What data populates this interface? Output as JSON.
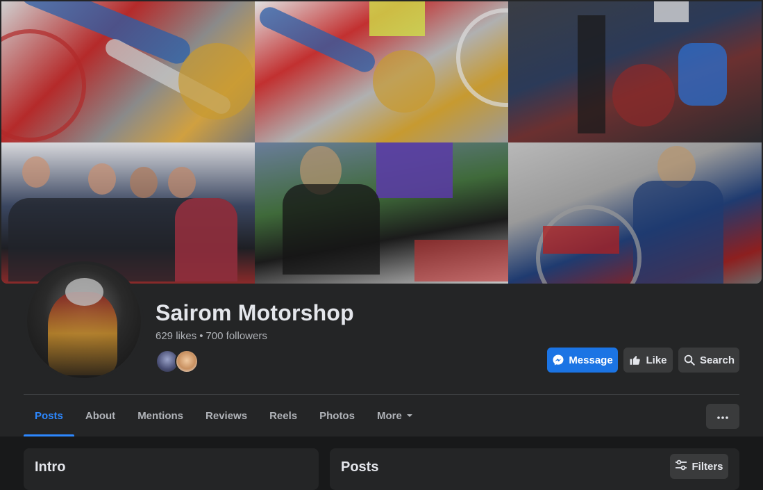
{
  "page": {
    "name": "Sairom Motorshop",
    "likes": "629 likes",
    "followers": "700 followers"
  },
  "actions": {
    "message": "Message",
    "like": "Like",
    "search": "Search"
  },
  "tabs": [
    {
      "label": "Posts",
      "active": true
    },
    {
      "label": "About"
    },
    {
      "label": "Mentions"
    },
    {
      "label": "Reviews"
    },
    {
      "label": "Reels"
    },
    {
      "label": "Photos"
    },
    {
      "label": "More"
    }
  ],
  "sections": {
    "intro_title": "Intro",
    "posts_title": "Posts",
    "filters": "Filters"
  },
  "colors": {
    "accent": "#2d88ff",
    "message_button": "#1b74e4",
    "background": "#18191a",
    "surface": "#242526"
  }
}
